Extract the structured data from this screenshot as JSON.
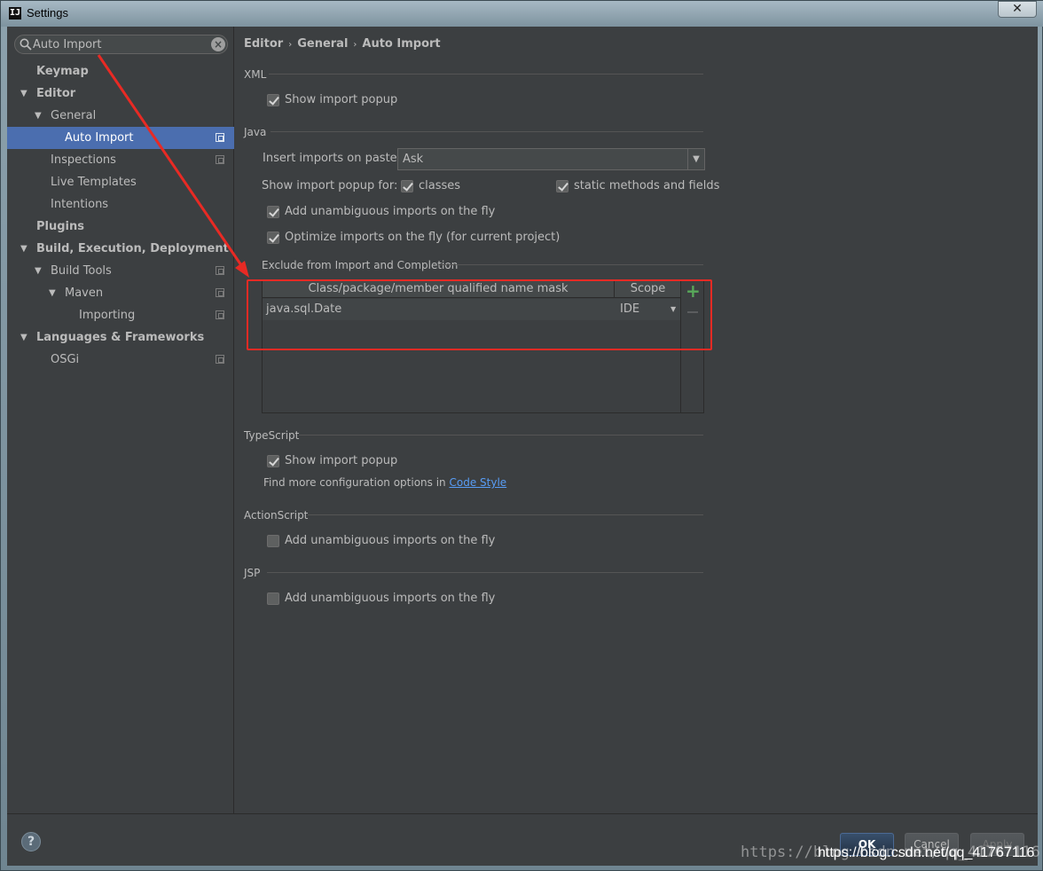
{
  "window": {
    "title": "Settings",
    "app_icon_text": "IJ",
    "close_glyph": "✕"
  },
  "search": {
    "value": "Auto Import",
    "placeholder": ""
  },
  "sidebar": {
    "items": [
      {
        "label": "Keymap"
      },
      {
        "label": "Editor"
      },
      {
        "label": "General"
      },
      {
        "label": "Auto Import"
      },
      {
        "label": "Inspections"
      },
      {
        "label": "Live Templates"
      },
      {
        "label": "Intentions"
      },
      {
        "label": "Plugins"
      },
      {
        "label": "Build, Execution, Deployment"
      },
      {
        "label": "Build Tools"
      },
      {
        "label": "Maven"
      },
      {
        "label": "Importing"
      },
      {
        "label": "Languages & Frameworks"
      },
      {
        "label": "OSGi"
      }
    ]
  },
  "breadcrumb": {
    "part1": "Editor",
    "part2": "General",
    "part3": "Auto Import",
    "sep": "›"
  },
  "xml": {
    "title": "XML",
    "show_popup": "Show import popup"
  },
  "java": {
    "title": "Java",
    "insert_label": "Insert imports on paste:",
    "insert_value": "Ask",
    "show_popup_for": "Show import popup for:",
    "classes": "classes",
    "static_methods": "static methods and fields",
    "add_unambiguous": "Add unambiguous imports on the fly",
    "optimize": "Optimize imports on the fly (for current project)",
    "exclude_title": "Exclude from Import and Completion",
    "table": {
      "col1": "Class/package/member qualified name mask",
      "col2": "Scope",
      "rows": [
        {
          "mask": "java.sql.Date",
          "scope": "IDE"
        }
      ]
    }
  },
  "typescript": {
    "title": "TypeScript",
    "show_popup": "Show import popup",
    "find_more": "Find more configuration options in",
    "code_style_link": "Code Style"
  },
  "actionscript": {
    "title": "ActionScript",
    "add_unambiguous": "Add unambiguous imports on the fly"
  },
  "jsp": {
    "title": "JSP",
    "add_unambiguous": "Add unambiguous imports on the fly"
  },
  "footer": {
    "help": "?",
    "ok": "OK",
    "cancel": "Cancel",
    "apply": "Apply"
  },
  "watermark": {
    "faded": "https://blog.csdn.net/qq_41767116",
    "url": "https://blog.csdn.net/qq_41767116"
  },
  "colors": {
    "background": "#3c3f41",
    "selection": "#4b6eaf",
    "annotation": "#e82a24",
    "link": "#589df6"
  }
}
